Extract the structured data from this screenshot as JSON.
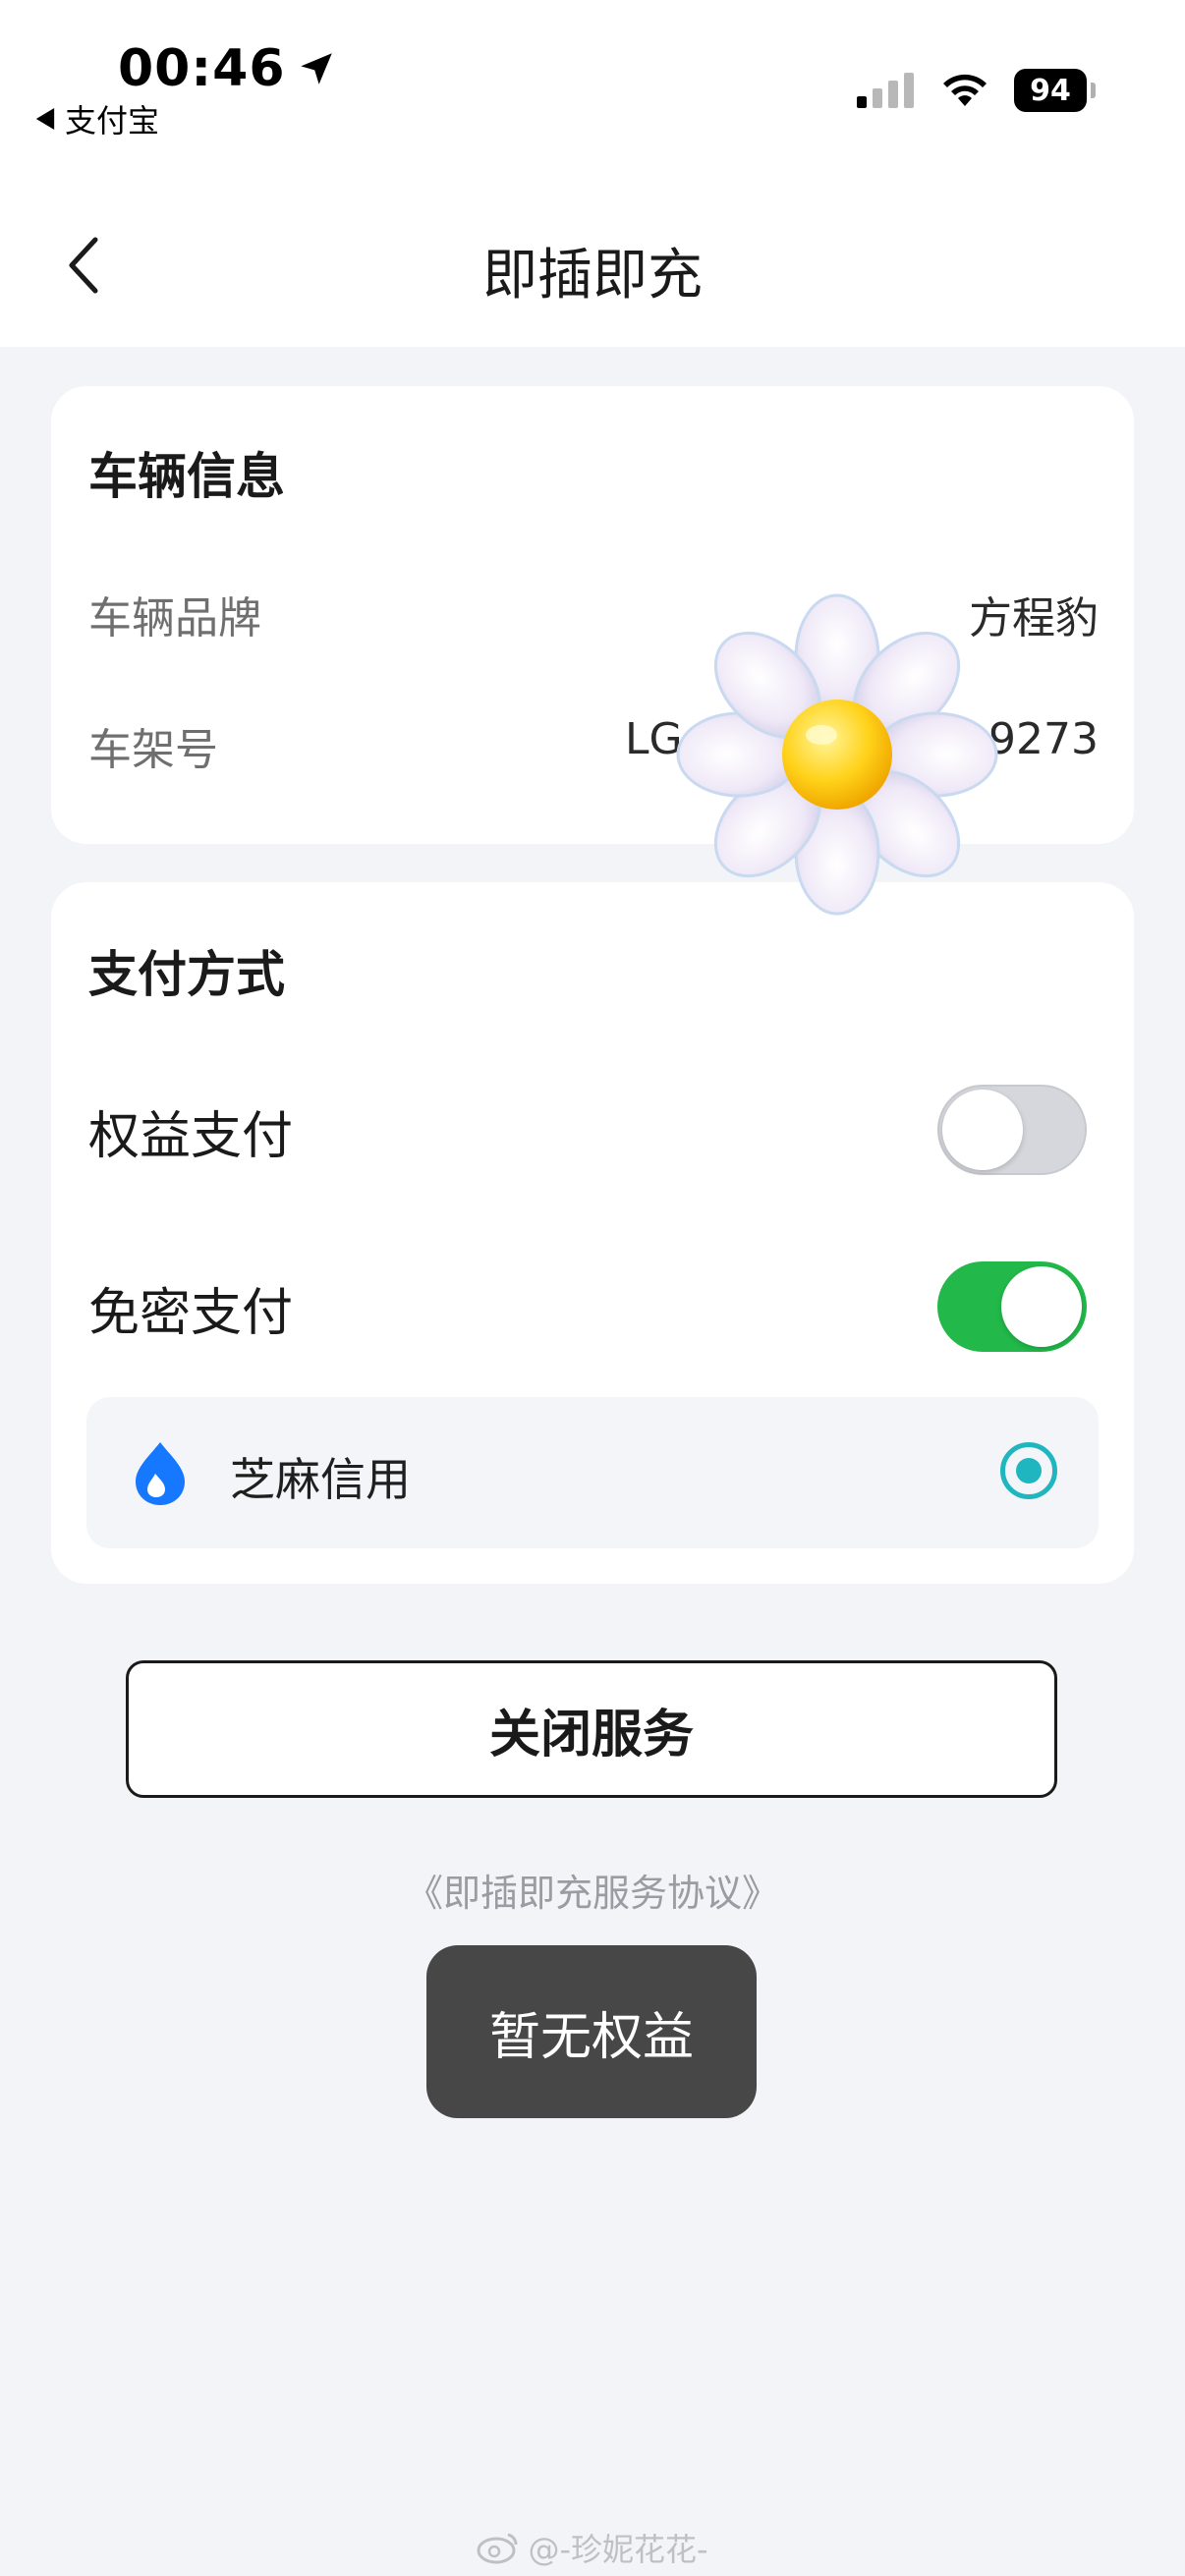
{
  "status_bar": {
    "time": "00:46",
    "back_app": "支付宝",
    "battery": "94"
  },
  "nav": {
    "title": "即插即充"
  },
  "vehicle": {
    "title": "车辆信息",
    "brand_label": "车辆品牌",
    "brand_value": "方程豹",
    "vin_label": "车架号",
    "vin_prefix": "LG",
    "vin_suffix": "9273"
  },
  "payment": {
    "title": "支付方式",
    "benefit_label": "权益支付",
    "benefit_enabled": false,
    "nopwd_label": "免密支付",
    "nopwd_enabled": true,
    "credit_label": "芝麻信用",
    "credit_selected": true
  },
  "actions": {
    "close_service": "关闭服务",
    "agreement": "《即插即充服务协议》"
  },
  "toast": {
    "message": "暂无权益"
  },
  "watermark": {
    "text": "@-珍妮花花-"
  },
  "colors": {
    "toggle_on": "#22b94a",
    "toggle_off": "#d5d7dd",
    "radio_accent": "#1fb6bf",
    "credit_icon": "#1677ff",
    "page_bg": "#f3f4f8"
  },
  "icons": {
    "back": "chevron-left-icon",
    "location": "location-arrow-icon",
    "signal": "cellular-signal-icon",
    "wifi": "wifi-icon",
    "credit": "sesame-credit-icon",
    "sticker": "daisy-sticker-icon"
  }
}
